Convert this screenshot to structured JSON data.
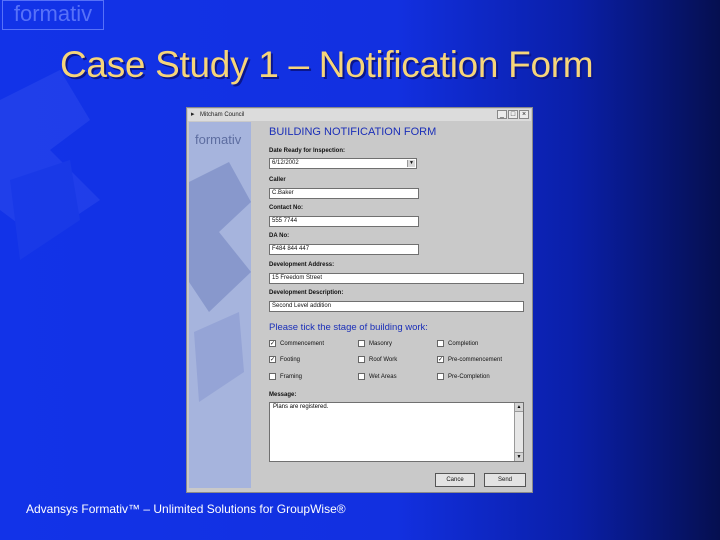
{
  "slide": {
    "brand_corner": "formativ",
    "title": "Case Study 1 – Notification Form",
    "footer": "Advansys Formativ™ – Unlimited Solutions for GroupWise®"
  },
  "window": {
    "title": "Mitcham Council",
    "buttons": [
      "_",
      "□",
      "×"
    ],
    "side_logo": "formativ"
  },
  "form": {
    "title": "BUILDING NOTIFICATION FORM",
    "date_label": "Date Ready for Inspection:",
    "date_value": "6/12/2002",
    "caller_label": "Caller",
    "caller_value": "C.Baker",
    "contact_label": "Contact No:",
    "contact_value": "555 7744",
    "da_label": "DA No:",
    "da_value": "F484 844 447",
    "dev_address_label": "Development Address:",
    "dev_address_value": "15 Freedom Street",
    "dev_desc_label": "Development Description:",
    "dev_desc_value": "Second Level addition",
    "stage_title": "Please tick the stage of building work:",
    "stages": [
      {
        "label": "Commencement",
        "checked": true
      },
      {
        "label": "Masonry",
        "checked": false
      },
      {
        "label": "Completion",
        "checked": false
      },
      {
        "label": "Footing",
        "checked": true
      },
      {
        "label": "Roof Work",
        "checked": false
      },
      {
        "label": "Pre-commencement",
        "checked": true
      },
      {
        "label": "Framing",
        "checked": false
      },
      {
        "label": "Wet Areas",
        "checked": false
      },
      {
        "label": "Pre-Completion",
        "checked": false
      }
    ],
    "message_label": "Message:",
    "message_value": "Plans are registered.",
    "cancel_label": "Cance",
    "send_label": "Send"
  },
  "colors": {
    "title_text": "#f6d57a",
    "form_heading": "#1b2fb8",
    "background_blue": "#1233e8"
  }
}
